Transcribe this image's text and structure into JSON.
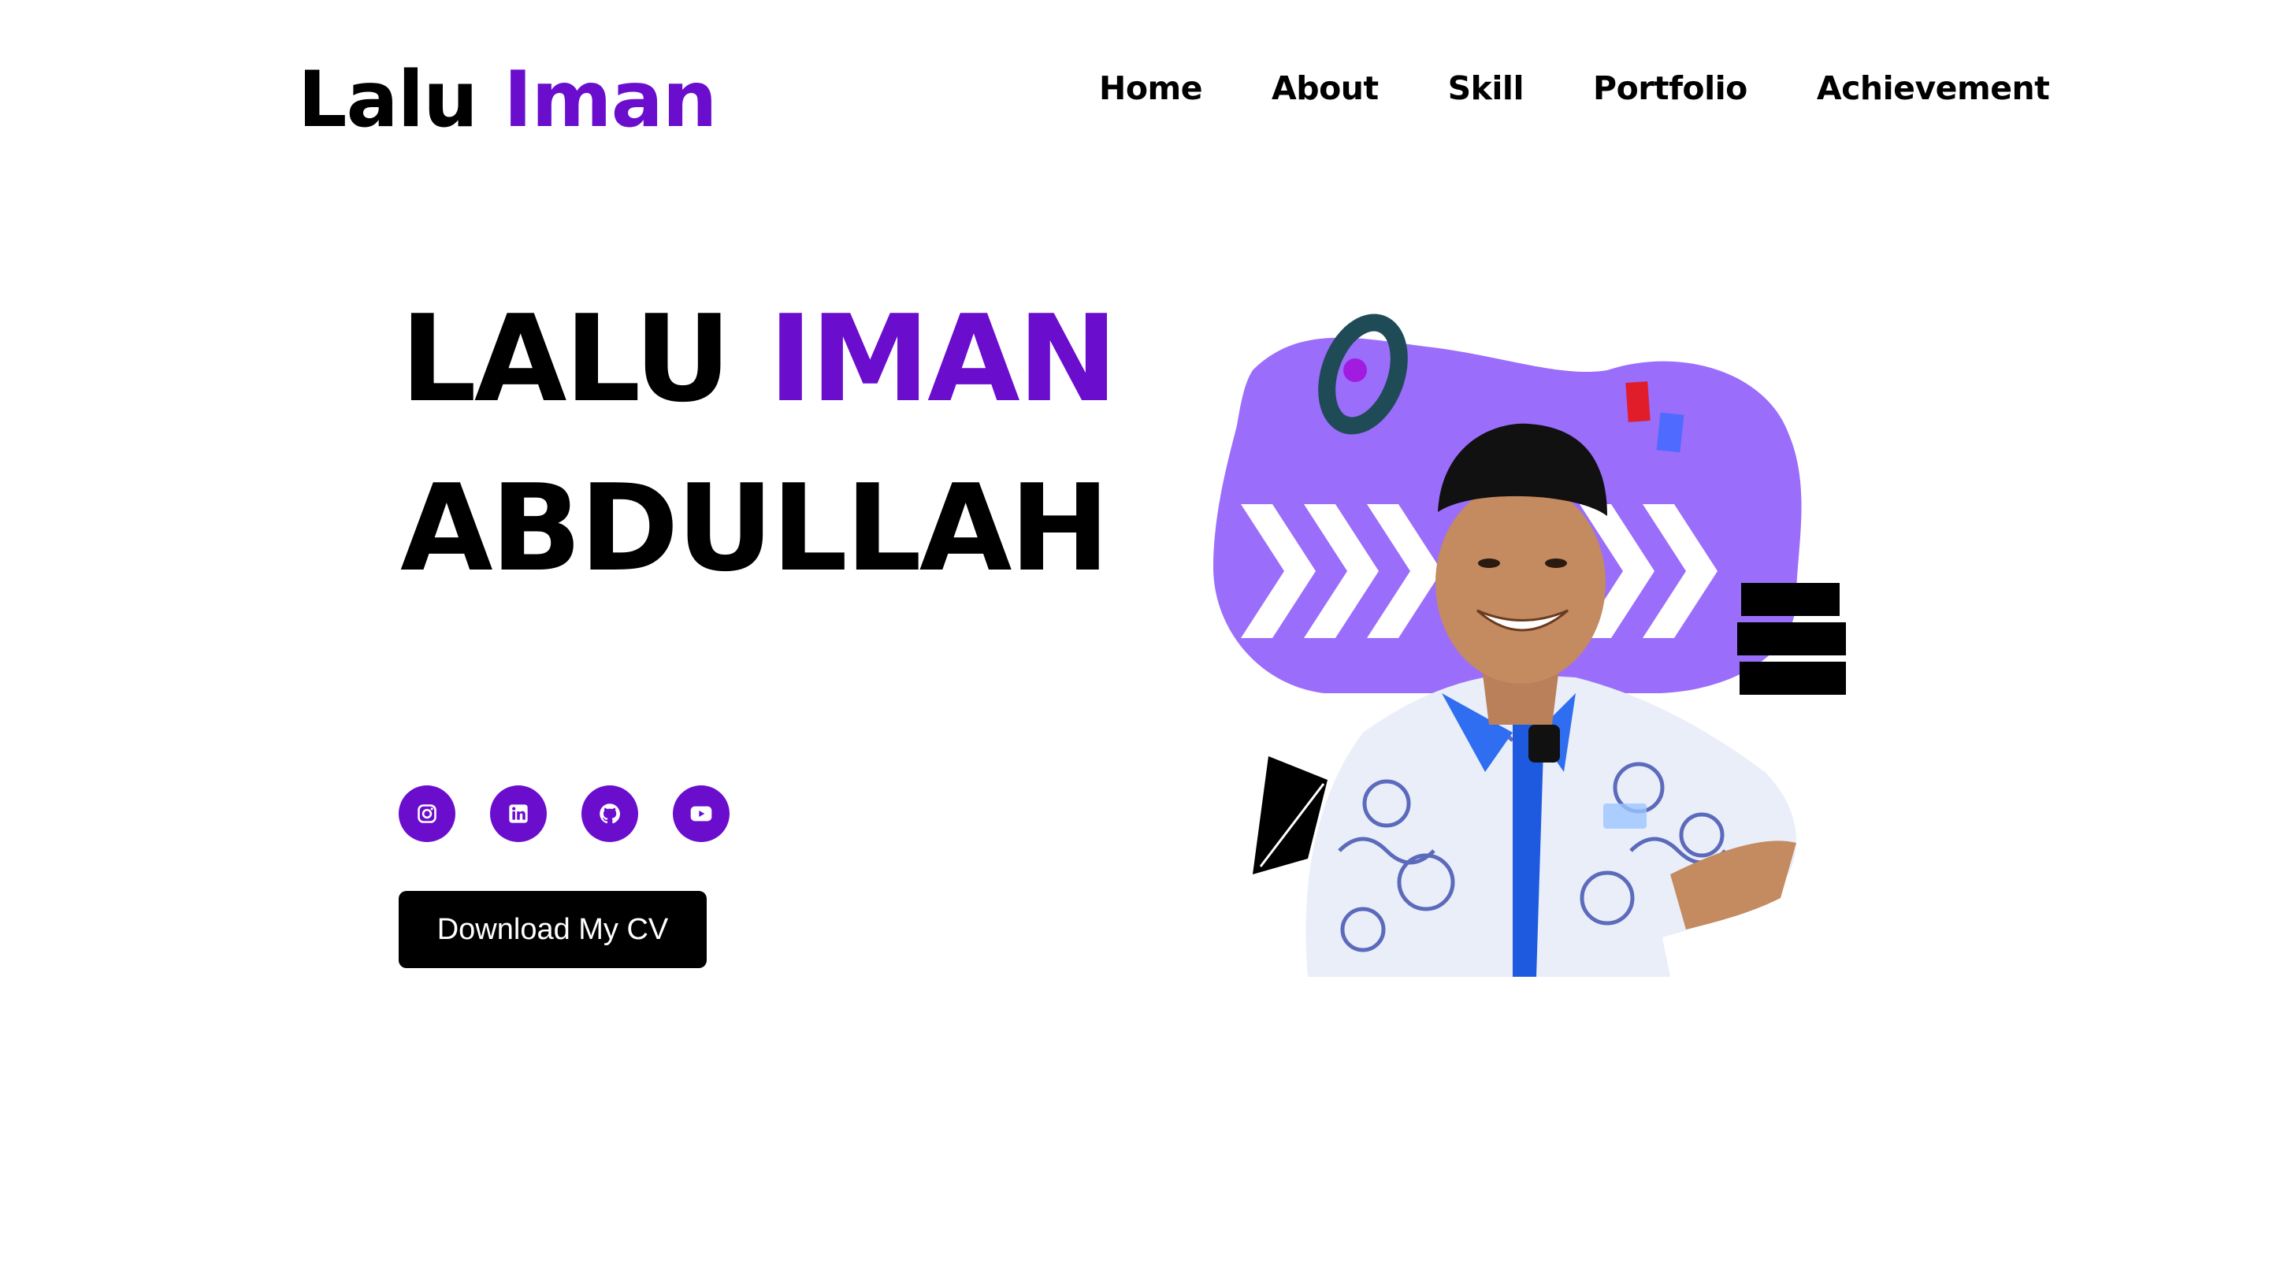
{
  "header": {
    "logo_first": "Lalu",
    "logo_second": "Iman"
  },
  "nav": {
    "items": [
      "Home",
      "About",
      "Skill",
      "Portfolio",
      "Achievement"
    ]
  },
  "hero": {
    "name_first": "LALU",
    "name_accent": "IMAN",
    "name_last": "ABDULLAH",
    "cv_button": "Download My CV"
  },
  "socials": [
    {
      "icon": "instagram-icon"
    },
    {
      "icon": "linkedin-icon"
    },
    {
      "icon": "github-icon"
    },
    {
      "icon": "youtube-icon"
    }
  ],
  "colors": {
    "accent": "#6a0dcd",
    "blob": "#9b6dfb",
    "text": "#000000",
    "button_bg": "#000000",
    "button_text": "#ffffff"
  }
}
